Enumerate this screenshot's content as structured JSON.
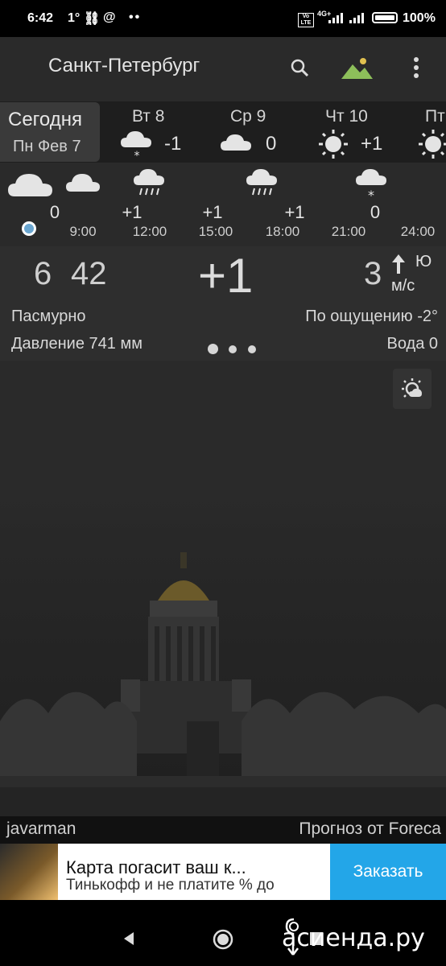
{
  "status_bar": {
    "time": "6:42",
    "temp": "1°",
    "battery": "100%",
    "network": "4G+"
  },
  "app_bar": {
    "city": "Санкт-Петербург",
    "icons": [
      "search-icon",
      "landscape-icon",
      "more-vert-icon"
    ]
  },
  "days": [
    {
      "label": "Сегодня",
      "sub": "Пн Фев 7"
    },
    {
      "label": "Вт 8",
      "temp": "-1",
      "icon": "cloud-snow-icon"
    },
    {
      "label": "Ср 9",
      "temp": "0",
      "icon": "cloud-icon"
    },
    {
      "label": "Чт 10",
      "temp": "+1",
      "icon": "sun-icon"
    },
    {
      "label": "Пт",
      "icon": "sun-icon"
    }
  ],
  "hourly": {
    "values": [
      "0",
      "+1",
      "+1",
      "+1",
      "0"
    ],
    "times": [
      "9:00",
      "12:00",
      "15:00",
      "18:00",
      "21:00",
      "24:00"
    ]
  },
  "current": {
    "time_hour": "6",
    "time_min": "42",
    "temp": "+1",
    "wind_speed": "3",
    "wind_dir": "Ю",
    "wind_unit": "м/с",
    "condition": "Пасмурно",
    "feels_like": "По ощущению -2°",
    "pressure": "Давление 741 мм",
    "water": "Вода 0"
  },
  "footer": {
    "author": "javarman",
    "credit": "Прогноз от Foreca"
  },
  "ad": {
    "title": "Карта погасит ваш к...",
    "subtitle": "Тинькофф и не платите % до",
    "button": "Заказать"
  },
  "watermark": "асиенда.ру",
  "colors": {
    "background": "#282828",
    "ad_button": "#23a6e8",
    "mountain_green": "#8dbf5a",
    "sun_yellow": "#e0c050"
  }
}
